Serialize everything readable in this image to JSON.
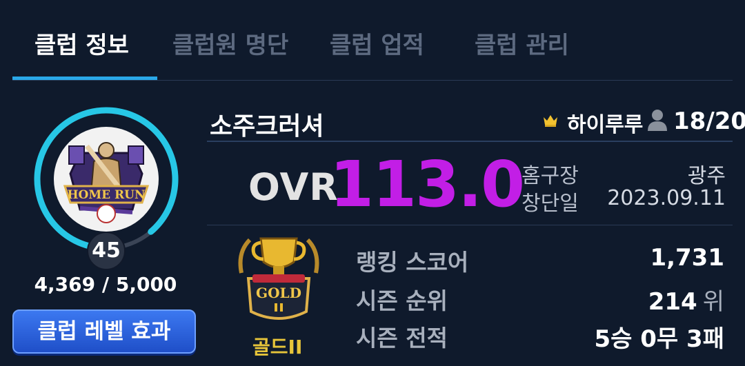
{
  "tabs": [
    {
      "label": "클럽 정보",
      "active": true
    },
    {
      "label": "클럽원 명단",
      "active": false
    },
    {
      "label": "클럽 업적",
      "active": false
    },
    {
      "label": "클럽 관리",
      "active": false
    }
  ],
  "club": {
    "name": "소주크러셔",
    "leader": "하이루루",
    "member_count": "18/20",
    "emblem_text": "HOME RUN",
    "level": "45",
    "exp_text": "4,369 / 5,000",
    "exp_progress": 0.8738,
    "level_effect_label": "클럽 레벨 효과"
  },
  "ovr": {
    "label": "OVR",
    "value": "113.0"
  },
  "info": {
    "home_label": "홈구장",
    "home_value": "광주",
    "founded_label": "창단일",
    "founded_value": "2023.09.11"
  },
  "league": {
    "name": "골드II",
    "badge_text": "GOLD"
  },
  "stats": {
    "ranking_score_label": "랭킹 스코어",
    "ranking_score_value": "1,731",
    "season_rank_label": "시즌 순위",
    "season_rank_value": "214",
    "season_rank_suffix": "위",
    "season_record_label": "시즌 전적",
    "season_record_value": "5승 0무 3패"
  },
  "colors": {
    "background": "#0f1a2c",
    "tab_accent": "#2aa8e8",
    "ovr": "#c21ee6",
    "ring": "#27c7e6",
    "gold": "#e7c53a",
    "button": "#2f66e0"
  },
  "icons": [
    "crown-icon",
    "member-icon",
    "club-emblem",
    "gold-league-trophy"
  ]
}
